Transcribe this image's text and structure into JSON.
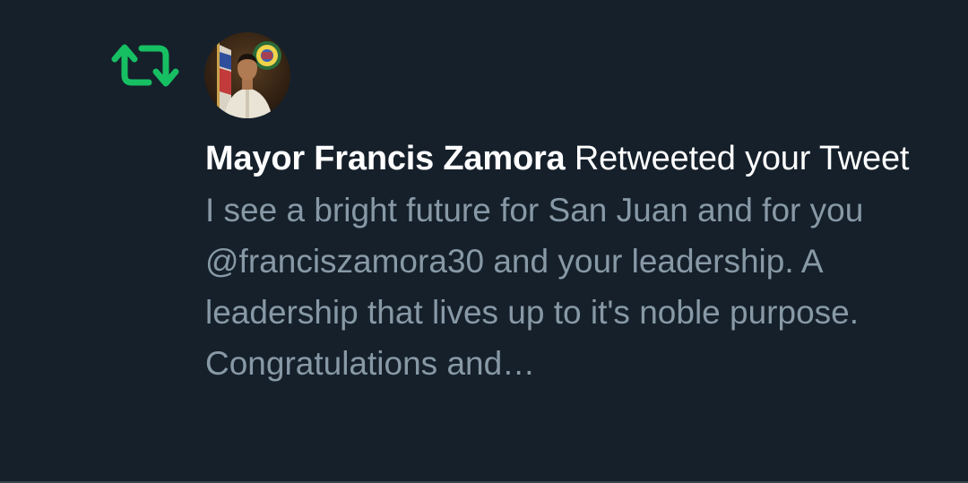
{
  "notification": {
    "icon": "retweet-icon",
    "icon_color": "#17bf63",
    "actor_name": "Mayor Francis Zamora",
    "action_text": "Retweeted your Tweet",
    "tweet_text": "I see a bright future for San Juan and for you @franciszamora30 and your leadership. A leadership that lives up to it's noble purpose. Congratulations and…"
  },
  "colors": {
    "background": "#15202b",
    "primary_text": "#ffffff",
    "secondary_text": "#8899a6",
    "divider": "#38444d"
  }
}
